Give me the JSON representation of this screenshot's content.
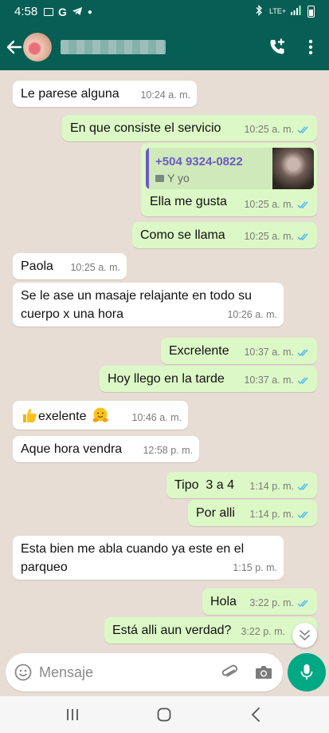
{
  "status_bar": {
    "time": "4:58",
    "network": "LTE+"
  },
  "header": {
    "contact_name_blurred": true
  },
  "messages": [
    {
      "dir": "in",
      "text": "Le parese alguna",
      "time": "10:24 a. m."
    },
    {
      "dir": "out",
      "text": "En que consiste el servicio",
      "time": "10:25 a. m."
    },
    {
      "dir": "out",
      "quote_phone": "+504 9324-0822",
      "quote_sub": "Y yo",
      "text": "Ella me gusta",
      "time": "10:25 a. m."
    },
    {
      "dir": "out",
      "text": "Como se llama",
      "time": "10:25 a. m."
    },
    {
      "dir": "in",
      "text": "Paola",
      "time": "10:25 a. m."
    },
    {
      "dir": "in",
      "text": "Se le ase un masaje relajante en todo su cuerpo x una hora",
      "line1": "Se le ase un masaje relajante en todo su",
      "line2": "cuerpo x una hora",
      "time": "10:26 a. m."
    },
    {
      "dir": "out",
      "text": "Excrelente",
      "time": "10:37 a. m."
    },
    {
      "dir": "out",
      "text": "Hoy llego en la tarde",
      "time": "10:37 a. m."
    },
    {
      "dir": "in",
      "text": "exelente",
      "emoji_before": "thumbs-up",
      "emoji_after": "hugging-face",
      "time": "10:46 a. m."
    },
    {
      "dir": "in",
      "text": "Aque hora vendra",
      "time": "12:58 p. m."
    },
    {
      "dir": "out",
      "text": "Tipo  3 a 4",
      "time": "1:14 p. m."
    },
    {
      "dir": "out",
      "text": "Por alli",
      "time": "1:14 p. m."
    },
    {
      "dir": "in",
      "text": "Esta bien me abla cuando ya este en el parqueo",
      "line1": "Esta bien me abla cuando ya este en el",
      "line2": "parqueo",
      "time": "1:15 p. m."
    },
    {
      "dir": "out",
      "text": "Hola",
      "time": "3:22 p. m."
    },
    {
      "dir": "out",
      "text": "Está alli aun verdad?",
      "time": "3:22 p. m."
    }
  ],
  "composer": {
    "placeholder": "Mensaje"
  },
  "colors": {
    "header": "#075e54",
    "bubble_out": "#dcf8c6",
    "bubble_in": "#ffffff",
    "read_ticks": "#4fb6ec",
    "mic": "#00a884"
  }
}
